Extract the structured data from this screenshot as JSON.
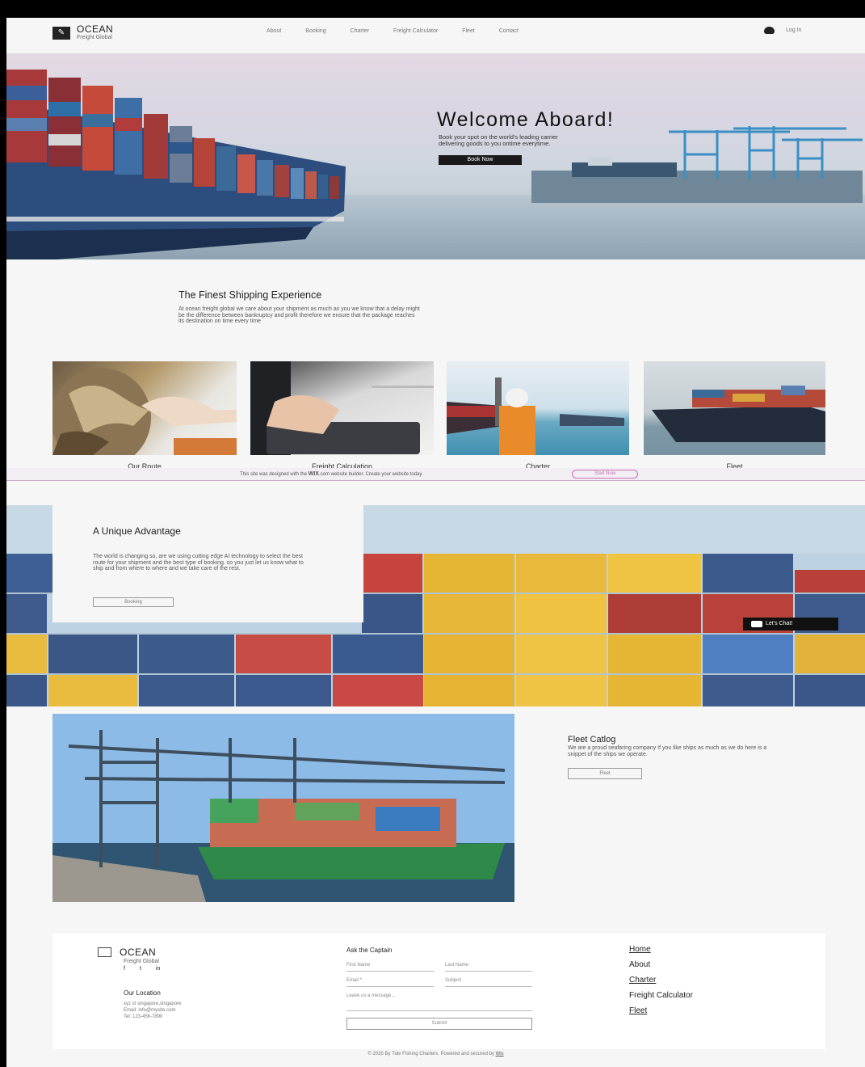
{
  "header": {
    "brand": "OCEAN",
    "brand_sub": "Freight Global",
    "nav": [
      "About",
      "Booking",
      "Charter",
      "Freight Calculator",
      "Fleet",
      "Contact"
    ],
    "login_label": "Log In"
  },
  "hero": {
    "title": "Welcome Aboard!",
    "subtitle": "Book your spot on the world's leading carrier\ndelivering goods to you ontime everytime.",
    "button": "Book Now"
  },
  "finest": {
    "title": "The Finest Shipping Experience",
    "body": "At ocean freight global we care about your shipment as much as you we know that a delay might be the difference between bankruptcy and profit therefore we ensure that the package reaches its destination on time every time"
  },
  "cards": [
    {
      "label": "Our Route"
    },
    {
      "label": "Freight Calculation"
    },
    {
      "label": "Charter"
    },
    {
      "label": "Fleet"
    }
  ],
  "wix_banner": {
    "text_before": "This site was designed with the ",
    "brand": "WIX",
    "text_after": ".com website builder. Create your website today.",
    "button": "Start Now"
  },
  "advantage": {
    "title": "A Unique Advantage",
    "body": "The world is changing so, are we using cutting edge AI technology to select the best route for your shipment and the best type of booking. so you just let us know what to ship and from where to where and we take care of the rest.",
    "button": "Booking"
  },
  "chat": {
    "label": "Let's Chat!"
  },
  "fleet": {
    "title": "Fleet Catlog",
    "body": "We are a proud seafaring company If you like ships as much as we do here is a snippet of the ships we operate.",
    "button": "Fleet"
  },
  "footer": {
    "brand": "OCEAN",
    "brand_sub": "Freight Global",
    "social": [
      "f",
      "t",
      "in"
    ],
    "location_title": "Our Location",
    "address": "xyz st singapore,singapore",
    "email": "Email: info@mysite.com",
    "tel": "Tel: 123-456-7890",
    "form_title": "Ask the Captain",
    "first_name": "First Name",
    "last_name": "Last Name",
    "email_field": "Email *",
    "subject": "Subject",
    "message": "Leave us a message...",
    "submit": "Submit",
    "links": [
      "Home",
      "About",
      "Charter",
      "Freight Calculator",
      "Fleet"
    ]
  },
  "copyright": {
    "text": "© 2035 By Tide Fishing Charters. Powered and secured by ",
    "link": "Wix"
  },
  "colors": {
    "accent_dark": "#1a1a1a",
    "wix_pink": "#c86fb2",
    "background": "#f6f6f6"
  }
}
